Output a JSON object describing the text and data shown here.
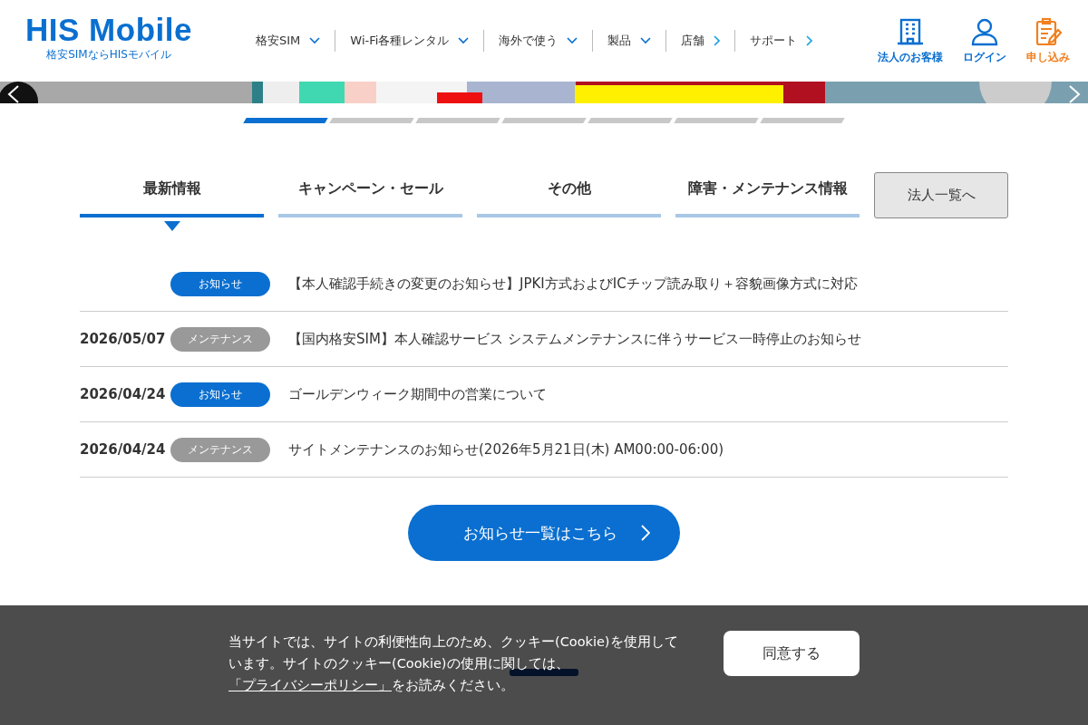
{
  "header": {
    "logo": {
      "name": "HIS Mobile",
      "tagline": "格安SIMならHISモバイル"
    },
    "nav": [
      {
        "label": "格安SIM",
        "kind": "dropdown"
      },
      {
        "label": "Wi-Fi各種レンタル",
        "kind": "dropdown"
      },
      {
        "label": "海外で使う",
        "kind": "dropdown"
      },
      {
        "label": "製品",
        "kind": "dropdown"
      },
      {
        "label": "店舗",
        "kind": "link"
      },
      {
        "label": "サポート",
        "kind": "link"
      }
    ],
    "actions": [
      {
        "label": "法人のお客様",
        "kind": "building"
      },
      {
        "label": "ログイン",
        "kind": "user"
      },
      {
        "label": "申し込み",
        "kind": "form"
      }
    ]
  },
  "carousel": {
    "kind": "picture",
    "slides": [
      {
        "selected": true
      },
      {
        "selected": false
      },
      {
        "selected": false
      },
      {
        "selected": false
      },
      {
        "selected": false
      },
      {
        "selected": false
      },
      {
        "selected": false
      }
    ]
  },
  "news": {
    "tabs": [
      {
        "label": "最新情報",
        "selected": true
      },
      {
        "label": "キャンペーン・セール",
        "selected": false
      },
      {
        "label": "その他",
        "selected": false
      },
      {
        "label": "障害・メンテナンス情報",
        "selected": false
      }
    ],
    "side_button": "法人一覧へ",
    "items": [
      {
        "badge": "お知らせ",
        "kind": "notice",
        "title": "【本人確認手続きの変更のお知らせ】JPKI方式およびICチップ読み取り＋容貌画像方式に対応"
      },
      {
        "date": "2026/05/07",
        "badge": "メンテナンス",
        "kind": "maintenance",
        "title": "【国内格安SIM】本人確認サービス システムメンテナンスに伴うサービス一時停止のお知らせ"
      },
      {
        "date": "2026/04/24",
        "badge": "お知らせ",
        "kind": "notice",
        "title": "ゴールデンウィーク期間中の営業について"
      },
      {
        "date": "2026/04/24",
        "badge": "メンテナンス",
        "kind": "maintenance",
        "title": "サイトメンテナンスのお知らせ(2026年5月21日(木) AM00:00-06:00)"
      }
    ],
    "more_button": "お知らせ一覧はこちら"
  },
  "cookie_banner": {
    "text": "当サイトでは、サイトの利便性向上のため、クッキー(Cookie)を使用しています。サイトのクッキー(Cookie)の使用に関しては、",
    "link": "「プライバシーポリシー」",
    "suffix": "をお読みください。",
    "button": "同意する"
  }
}
